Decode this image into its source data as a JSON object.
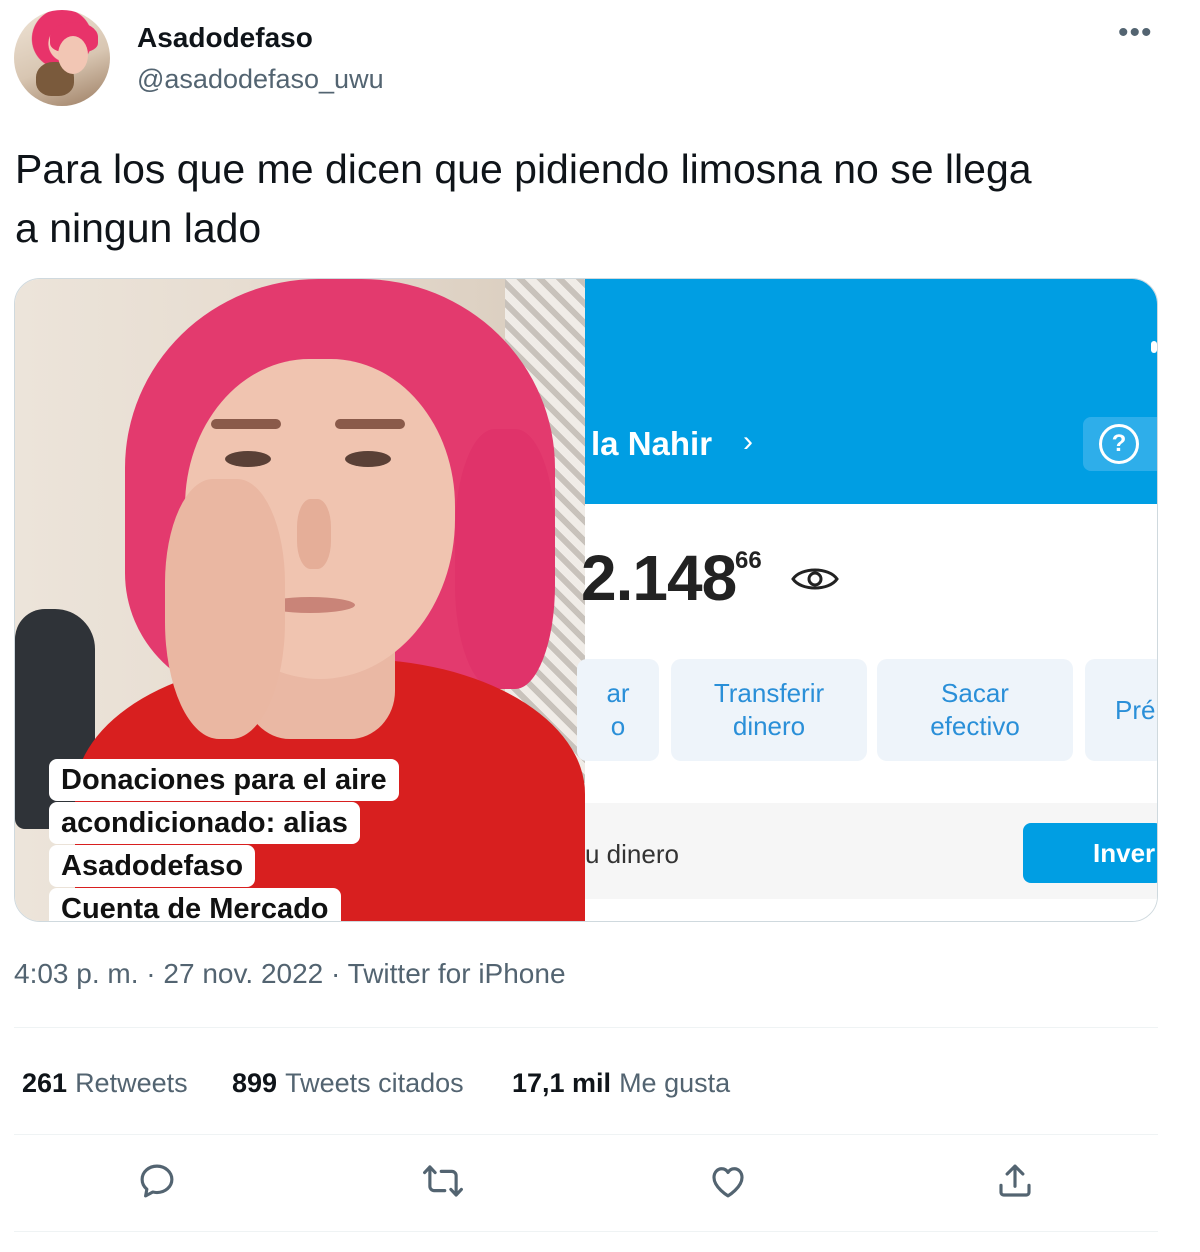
{
  "author": {
    "display_name": "Asadodefaso",
    "handle": "@asadodefaso_uwu"
  },
  "menu": {
    "more_label": "•••"
  },
  "tweet": {
    "text_line1": "Para los que me dicen que pidiendo limosna no se llega",
    "text_line2": "a ningun lado"
  },
  "media": {
    "photo_caption": [
      "Donaciones para el aire",
      "acondicionado: alias",
      "Asadodefaso",
      "Cuenta de Mercado"
    ],
    "app": {
      "account_name": "la Nahir",
      "chevron": "›",
      "help_glyph": "?",
      "balance": "2.148",
      "cents": "66",
      "tiles": [
        {
          "line1": "ar",
          "line2": "o"
        },
        {
          "line1": "Transferir",
          "line2": "dinero"
        },
        {
          "line1": "Sacar",
          "line2": "efectivo"
        },
        {
          "line1": "Pré",
          "line2": ""
        }
      ],
      "money_text": "u dinero",
      "invest_button": "Inver",
      "colors": {
        "brand_blue": "#009ee3",
        "tile_text": "#2a8fd8"
      }
    }
  },
  "timestamp": {
    "time": "4:03 p. m.",
    "sep1": " · ",
    "date": "27 nov. 2022",
    "sep2": " · ",
    "source": "Twitter for iPhone"
  },
  "stats": {
    "retweets_count": "261",
    "retweets_label": "Retweets",
    "quotes_count": "899",
    "quotes_label": "Tweets citados",
    "likes_count": "17,1 mil",
    "likes_label": "Me gusta"
  },
  "actions": [
    "reply-icon",
    "retweet-icon",
    "like-icon",
    "share-icon"
  ]
}
